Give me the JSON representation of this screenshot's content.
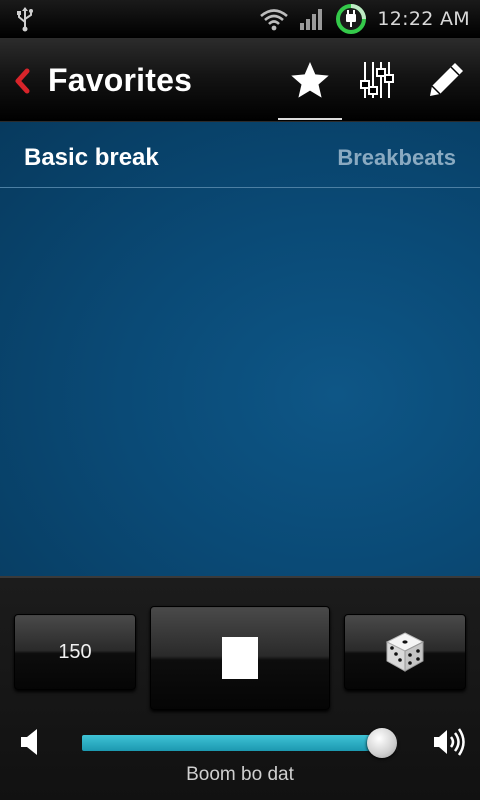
{
  "status_bar": {
    "time": "12:22 AM",
    "icons": [
      "usb-icon",
      "wifi-icon",
      "signal-icon",
      "battery-charging-icon"
    ],
    "battery_ring_color": "#34c94a"
  },
  "action_bar": {
    "title": "Favorites",
    "tabs": [
      {
        "icon": "star-icon",
        "selected": true
      },
      {
        "icon": "mixer-icon",
        "selected": false
      },
      {
        "icon": "pencil-icon",
        "selected": false
      }
    ],
    "back_color": "#d8242a"
  },
  "list": {
    "items": [
      {
        "name": "Basic break",
        "category": "Breakbeats"
      }
    ]
  },
  "controls": {
    "tempo": "150",
    "play_state": "stop",
    "volume_fraction": 0.95,
    "pattern_name": "Boom bo dat",
    "accent": "#2db3c8"
  }
}
